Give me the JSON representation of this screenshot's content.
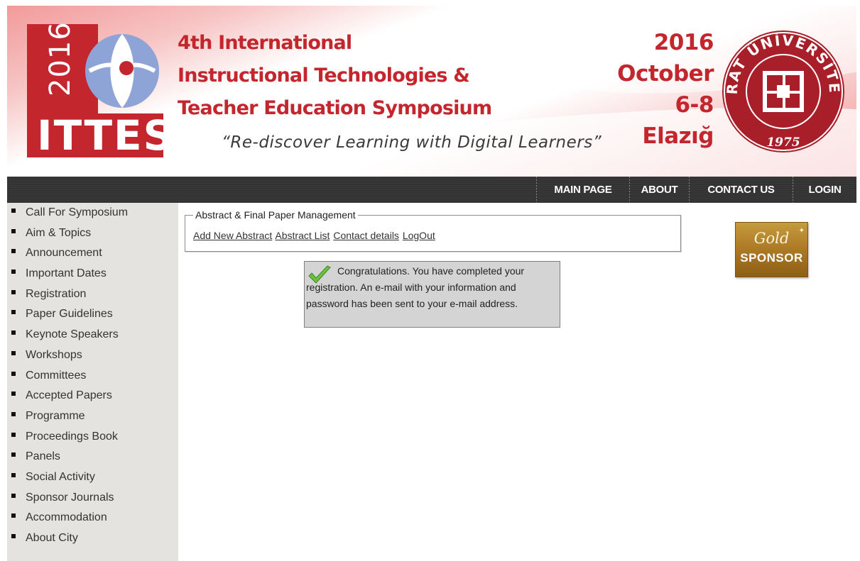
{
  "header": {
    "logo": {
      "year": "2016",
      "brand": "ITTES"
    },
    "title_lines": [
      "4th International",
      "Instructional Technologies &",
      "Teacher Education Symposium"
    ],
    "slogan": "“Re-discover Learning with Digital Learners”",
    "date_lines": [
      "2016",
      "October",
      "6-8",
      "Elazığ"
    ],
    "seal": {
      "text": "FIRAT ÜNİVERSİTESİ",
      "year": "1975"
    }
  },
  "nav": {
    "items": [
      {
        "label": "MAIN PAGE"
      },
      {
        "label": "ABOUT"
      },
      {
        "label": "CONTACT US"
      },
      {
        "label": "LOGIN"
      }
    ]
  },
  "sidebar": {
    "items": [
      {
        "label": "Call For Symposium"
      },
      {
        "label": "Aim & Topics"
      },
      {
        "label": "Announcement"
      },
      {
        "label": "Important Dates"
      },
      {
        "label": "Registration"
      },
      {
        "label": "Paper Guidelines"
      },
      {
        "label": "Keynote Speakers"
      },
      {
        "label": "Workshops"
      },
      {
        "label": "Committees"
      },
      {
        "label": "Accepted Papers"
      },
      {
        "label": "Programme"
      },
      {
        "label": "Proceedings Book"
      },
      {
        "label": "Panels"
      },
      {
        "label": "Social Activity"
      },
      {
        "label": "Sponsor Journals"
      },
      {
        "label": "Accommodation"
      },
      {
        "label": "About City"
      }
    ]
  },
  "panel": {
    "legend": "Abstract & Final Paper Management",
    "links": [
      "Add New Abstract",
      "Abstract List",
      "Contact details",
      "LogOut"
    ]
  },
  "notice": {
    "icon": "check-icon",
    "message": "Congratulations. You have completed your registration. An e-mail with your information and password has been sent to your e-mail address."
  },
  "sponsor": {
    "tier": "Gold",
    "label": "SPONSOR"
  },
  "colors": {
    "brand_red": "#c4262e",
    "nav_bg": "#333333",
    "sidebar_bg": "#e4e3df",
    "notice_bg": "#d4d4d4",
    "sponsor_gold": "#a97622"
  }
}
